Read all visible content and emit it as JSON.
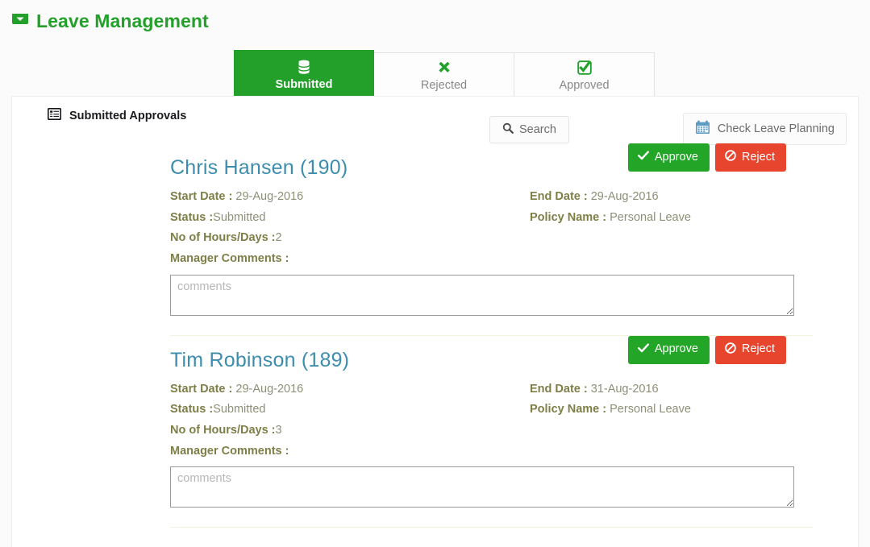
{
  "header": {
    "title": "Leave Management",
    "icon": "inbox-icon",
    "accent_color": "#22a02a"
  },
  "tabs": [
    {
      "label": "Submitted",
      "icon": "database-icon",
      "active": true
    },
    {
      "label": "Rejected",
      "icon": "times-icon",
      "active": false
    },
    {
      "label": "Approved",
      "icon": "check-square-icon",
      "active": false
    }
  ],
  "toolbar": {
    "section_title": "Submitted Approvals",
    "section_icon": "list-alt-icon",
    "search_label": "Search",
    "search_icon": "search-icon",
    "planning_label": "Check Leave Planning",
    "planning_icon": "calendar-icon"
  },
  "actions": {
    "approve_label": "Approve",
    "approve_icon": "check-icon",
    "approve_color": "#23a528",
    "reject_label": "Reject",
    "reject_icon": "ban-icon",
    "reject_color": "#e8452f"
  },
  "labels": {
    "start_date": "Start Date :",
    "end_date": "End Date :",
    "status": "Status :",
    "policy_name": "Policy Name :",
    "hours_days": "No of Hours/Days :",
    "manager_comments": "Manager Comments :"
  },
  "comments_placeholder": "comments",
  "records": [
    {
      "employee": "Chris Hansen (190)",
      "start_date": "29-Aug-2016",
      "end_date": "29-Aug-2016",
      "status": "Submitted",
      "policy_name": "Personal Leave",
      "hours_days": "2",
      "comments_value": ""
    },
    {
      "employee": "Tim Robinson (189)",
      "start_date": "29-Aug-2016",
      "end_date": "31-Aug-2016",
      "status": "Submitted",
      "policy_name": "Personal Leave",
      "hours_days": "3",
      "comments_value": ""
    }
  ]
}
